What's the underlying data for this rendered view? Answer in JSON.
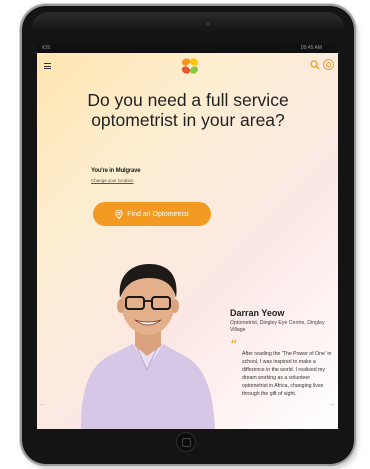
{
  "statusbar": {
    "carrier": "iOS",
    "time": "09:45 AM"
  },
  "header": {
    "menu_icon": "hamburger-menu-icon",
    "logo_icon": "four-petal-logo-icon",
    "search_icon": "search-icon",
    "location_icon": "location-pin-circle-icon"
  },
  "hero": {
    "headline": "Do you need a full service optometrist in your area?",
    "location_title": "You're in Mulgrave",
    "location_link": "Change your location",
    "cta_label": "Find an Optometrist"
  },
  "testimonial": {
    "name": "Darran Yeow",
    "role": "Optometrist, Dingley Eye Centre, Dingley Village",
    "quote": "After reading the 'The Power of One' in school, I was inspired to make a difference in the world. I realised my dream working as a volunteer optometrist in Africa, changing lives through the gift of sight."
  },
  "carousel": {
    "prev_icon": "arrow-left-icon",
    "next_icon": "arrow-right-icon"
  },
  "colors": {
    "accent": "#f39a22",
    "logo_orange": "#f7941d",
    "logo_yellow": "#ffc20e",
    "logo_red": "#e8542e",
    "logo_green": "#8dc63f"
  }
}
